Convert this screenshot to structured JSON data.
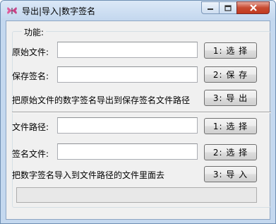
{
  "window": {
    "title": "导出|导入|数字签名",
    "icons": {
      "app": "butterfly-icon",
      "minimize": "minimize-icon",
      "maximize": "maximize-icon",
      "close": "close-icon"
    }
  },
  "group": {
    "title": "功能:"
  },
  "export": {
    "source_label": "原始文件:",
    "source_value": "",
    "choose_source_button": "1: 选 择",
    "save_label": "保存签名:",
    "save_value": "",
    "save_button": "2: 保 存",
    "description": "把原始文件的数字签名导出到保存签名文件路径",
    "export_button": "3: 导 出"
  },
  "import": {
    "path_label": "文件路径:",
    "path_value": "",
    "choose_path_button": "1: 选 择",
    "sig_label": "签名文件:",
    "sig_value": "",
    "choose_sig_button": "2: 选 择",
    "description": "把数字签名导入到文件路径的文件里面去",
    "import_button": "3: 导 入"
  },
  "status": {
    "text": ""
  },
  "colors": {
    "title_bar": "#c4d8ef",
    "close_button": "#c74b32",
    "client": "#f0f0f0"
  }
}
